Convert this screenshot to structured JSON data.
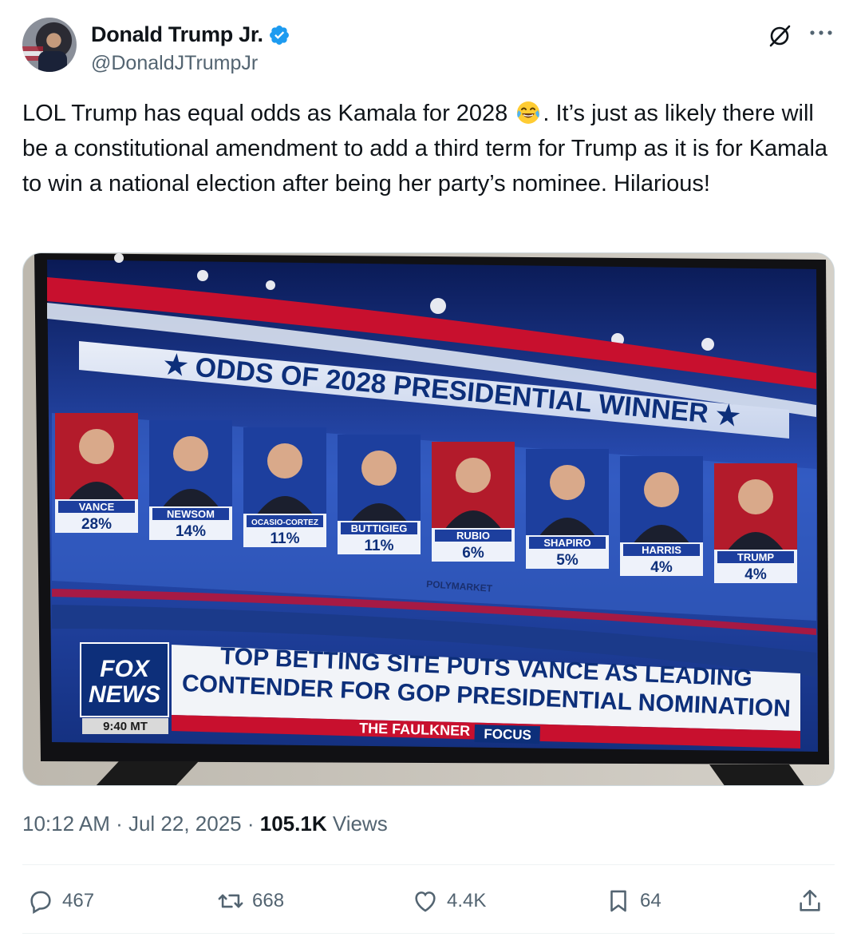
{
  "author": {
    "display_name": "Donald Trump Jr.",
    "handle": "@DonaldJTrumpJr",
    "verified": true,
    "badge_color": "#1d9bf0"
  },
  "tweet": {
    "text_part1": "LOL Trump has equal odds as Kamala for 2028 ",
    "emoji": "face-with-tears-of-joy",
    "text_part2": ". It’s just as likely there will be a constitutional amendment to add a third term for Trump as it is for Kamala to win a national election after being her party’s nominee. Hilarious!"
  },
  "media": {
    "headline": "★ ODDS OF 2028 PRESIDENTIAL WINNER ★",
    "candidates": [
      {
        "name": "VANCE",
        "odds": "28%"
      },
      {
        "name": "NEWSOM",
        "odds": "14%"
      },
      {
        "name": "OCASIO-CORTEZ",
        "odds": "11%"
      },
      {
        "name": "BUTTIGIEG",
        "odds": "11%"
      },
      {
        "name": "RUBIO",
        "odds": "6%"
      },
      {
        "name": "SHAPIRO",
        "odds": "5%"
      },
      {
        "name": "HARRIS",
        "odds": "4%"
      },
      {
        "name": "TRUMP",
        "odds": "4%"
      }
    ],
    "source": "POLYMARKET",
    "network_logo": {
      "line1": "FOX",
      "line2": "NEWS"
    },
    "clock": "9:40 MT",
    "chyron_line1": "TOP BETTING SITE PUTS VANCE AS LEADING",
    "chyron_line2": "CONTENDER FOR GOP PRESIDENTIAL NOMINATION",
    "show_name": "THE FAULKNER",
    "show_tag": "FOCUS"
  },
  "meta": {
    "time": "10:12 AM",
    "separator": " · ",
    "date": "Jul 22, 2025",
    "views_count": "105.1K",
    "views_label": " Views"
  },
  "actions": {
    "replies": "467",
    "reposts": "668",
    "likes": "4.4K",
    "bookmarks": "64"
  },
  "colors": {
    "text_primary": "#0f1419",
    "text_secondary": "#536471",
    "divider": "#eff3f4",
    "fox_blue": "#0d2f7a",
    "fox_red": "#c8102e"
  }
}
